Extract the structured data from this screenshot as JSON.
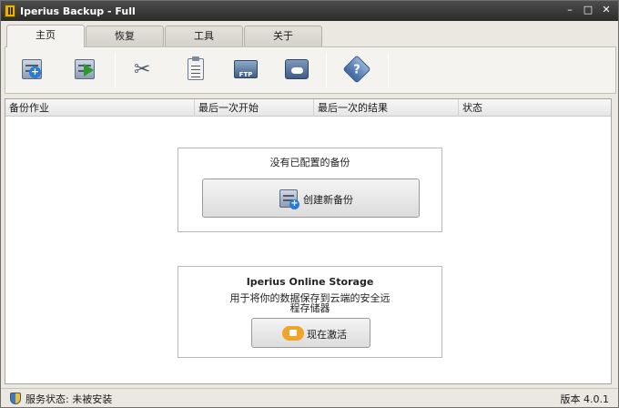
{
  "window": {
    "title": "Iperius Backup - Full"
  },
  "titlebar": {
    "minimize": "–",
    "maximize": "□",
    "close": "✕"
  },
  "tabs": [
    {
      "label": "主页",
      "active": true
    },
    {
      "label": "恢复",
      "active": false
    },
    {
      "label": "工具",
      "active": false
    },
    {
      "label": "关于",
      "active": false
    }
  ],
  "toolbar": {
    "icons": [
      "new-backup-icon",
      "run-backup-icon",
      "tools-icon",
      "clipboard-icon",
      "ftp-icon",
      "cloud-icon",
      "help-icon"
    ],
    "ftp_text": "FTP"
  },
  "columns": [
    "备份作业",
    "最后一次开始",
    "最后一次的结果",
    "状态"
  ],
  "empty_panel": {
    "message": "没有已配置的备份",
    "button_label": "创建新备份"
  },
  "online_storage": {
    "title": "Iperius Online Storage",
    "desc_line1": "用于将你的数据保存到云端的安全远",
    "desc_line2": "程存储器",
    "button_label": "现在激活"
  },
  "status_bar": {
    "service_status": "服务状态: 未被安装",
    "version": "版本 4.0.1"
  },
  "colors": {
    "titlebar": "#3a3a3a",
    "window_bg": "#ebe8e2",
    "accent_blue": "#2a7bd6",
    "play_green": "#2a9a2a",
    "storage_orange": "#f0a42a"
  }
}
